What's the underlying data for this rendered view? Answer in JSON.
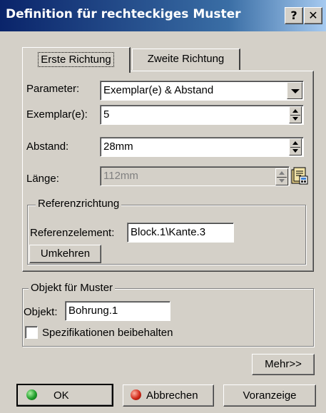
{
  "window": {
    "title": "Definition für rechteckiges Muster",
    "help_button": "?",
    "close_button": "✕"
  },
  "tabs": [
    {
      "label": "Erste Richtung",
      "active": true
    },
    {
      "label": "Zweite Richtung",
      "active": false
    }
  ],
  "parameters": {
    "parameter_label": "Parameter:",
    "parameter_value": "Exemplar(e) & Abstand",
    "instances_label": "Exemplar(e):",
    "instances_value": "5",
    "spacing_label": "Abstand:",
    "spacing_value": "28mm",
    "length_label": "Länge:",
    "length_value": "112mm"
  },
  "reference": {
    "group_label": "Referenzrichtung",
    "element_label": "Referenzelement:",
    "element_value": "Block.1\\Kante.3",
    "reverse_button": "Umkehren"
  },
  "object_group": {
    "group_label": "Objekt für Muster",
    "object_label": "Objekt:",
    "object_value": "Bohrung.1",
    "keep_specs_label": "Spezifikationen beibehalten",
    "keep_specs_checked": false
  },
  "buttons": {
    "more": "Mehr>>",
    "ok": "OK",
    "cancel": "Abbrechen",
    "preview": "Voranzeige"
  },
  "colors": {
    "title_start": "#0a246a",
    "title_end": "#a6caf0",
    "ok_dot": "#1f9d2a",
    "cancel_dot": "#d12a1a"
  },
  "icons": {
    "formula": "formula-icon",
    "spin": "spinner-icon",
    "dropdown": "chevron-down-icon"
  }
}
